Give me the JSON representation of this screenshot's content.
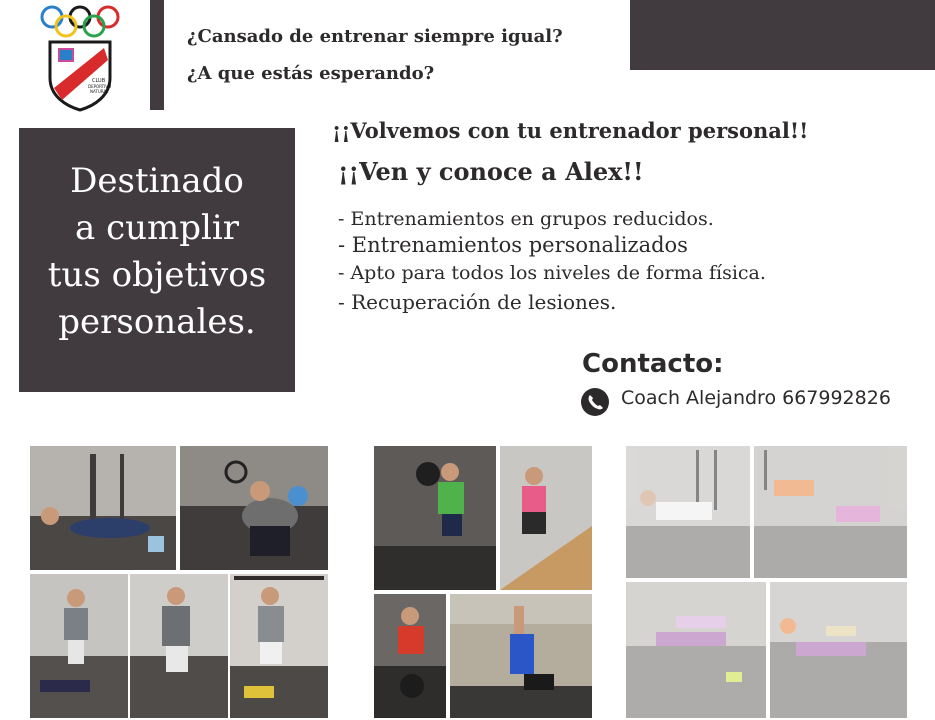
{
  "header": {
    "line1": "¿Cansado de entrenar siempre igual?",
    "line2": "¿A que estás esperando?"
  },
  "logo": {
    "text": "CLUB DEPORTIVO NATURAL",
    "ring_colors": [
      "#2a7fc9",
      "#f2c21b",
      "#1a1a1a",
      "#2aa24a",
      "#d92b2b"
    ]
  },
  "motto": {
    "line1": "Destinado",
    "line2": "a cumplir",
    "line3": "tus objetivos",
    "line4": "personales."
  },
  "announcement": {
    "heading1": "¡¡Volvemos con tu entrenador personal!!",
    "heading2": "¡¡Ven y conoce a Alex!!",
    "bullets": [
      "- Entrenamientos en grupos reducidos.",
      "- Entrenamientos personalizados",
      "- Apto para todos los niveles de forma física.",
      "- Recuperación de lesiones."
    ]
  },
  "contact": {
    "title": "Contacto:",
    "line": "Coach Alejandro 667992826",
    "icon": "phone-icon"
  },
  "colors": {
    "dark_panel": "#413b3f",
    "text": "#2d2a2c"
  }
}
